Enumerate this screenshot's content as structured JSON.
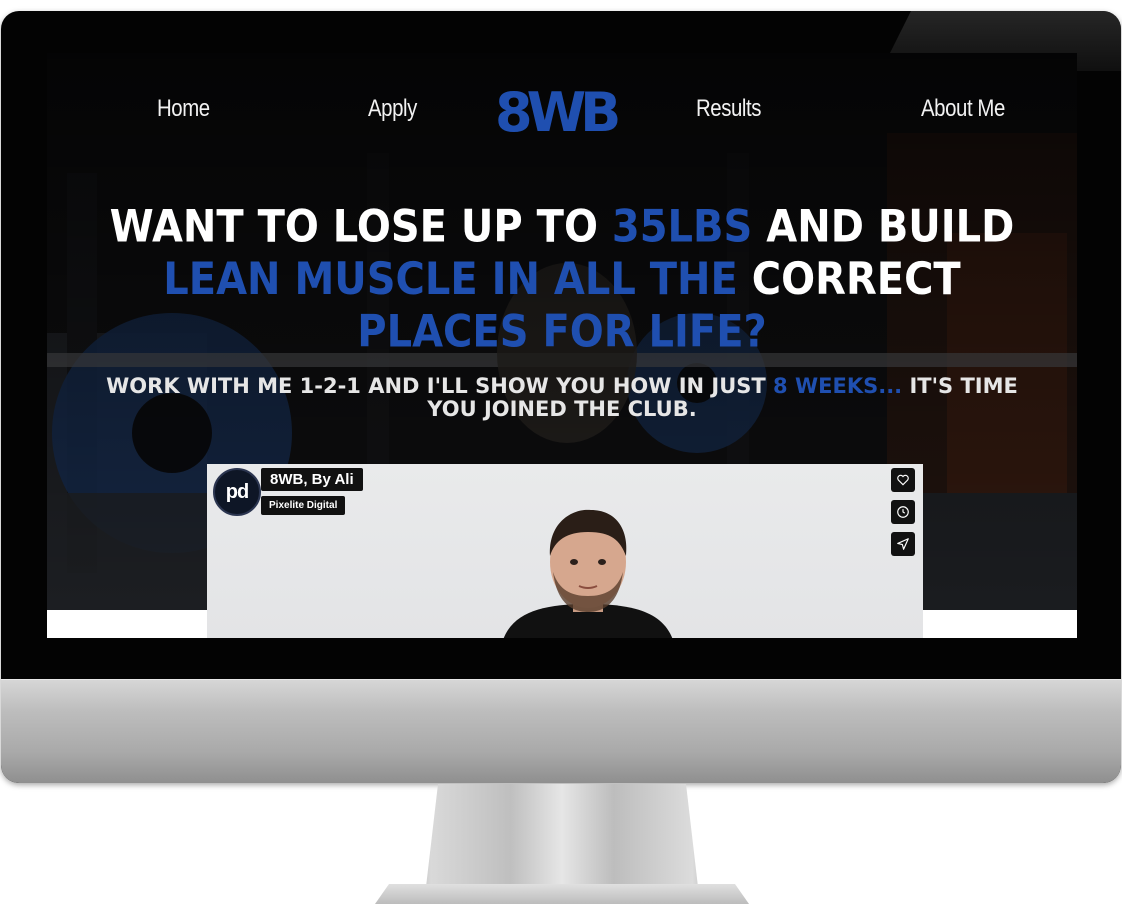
{
  "nav": {
    "home": "Home",
    "apply": "Apply",
    "logo": "8WB",
    "results": "Results",
    "about": "About Me"
  },
  "headline": {
    "part1": "WANT TO LOSE UP TO ",
    "part2_blue": "35LBS",
    "part3": " AND BUILD",
    "part4_blue": "LEAN MUSCLE IN ALL THE ",
    "part5": "CORRECT",
    "part6_blue": " PLACES FOR LIFE?"
  },
  "subline": {
    "part1": "WORK WITH ME 1-2-1 AND I'LL SHOW YOU HOW IN JUST ",
    "part2_blue": "8 WEEKS...",
    "part3": " IT'S TIME YOU JOINED THE CLUB."
  },
  "video": {
    "title": "8WB, By Ali",
    "channel": "Pixelite Digital",
    "avatar_text": "pd",
    "icons": [
      "heart-icon",
      "clock-icon",
      "send-icon"
    ]
  },
  "colors": {
    "accent_blue": "#1f4fb0",
    "hero_dark": "#0b0b0d",
    "white": "#ffffff"
  }
}
